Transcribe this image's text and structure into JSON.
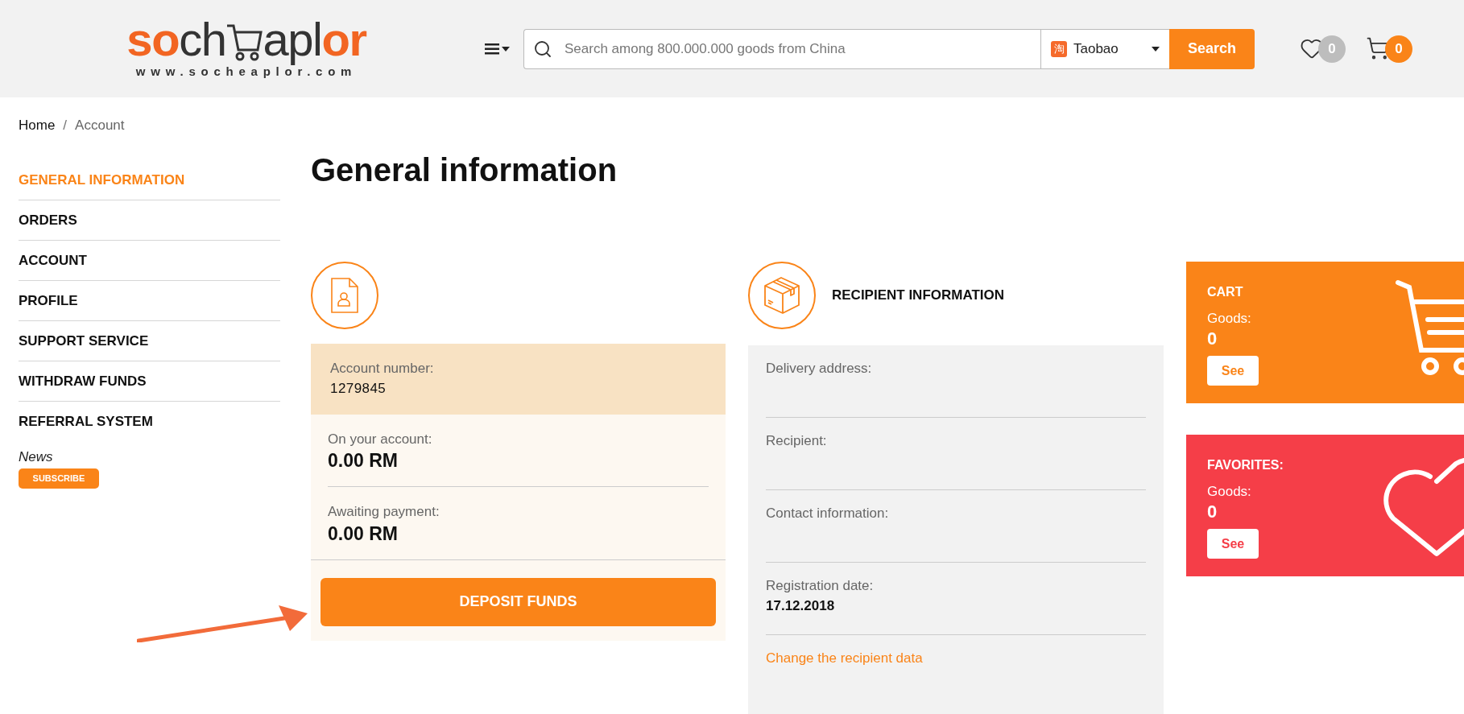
{
  "header": {
    "logo": {
      "parts": [
        {
          "text": "so",
          "color": "#f26522"
        },
        {
          "text": "ch",
          "color": "#333333"
        },
        {
          "text": "apl",
          "color": "#333333"
        },
        {
          "text": "or",
          "color": "#f26522"
        }
      ],
      "tagline": "www.socheaplor.com"
    },
    "search": {
      "placeholder": "Search among 800.000.000 goods from China",
      "source_glyph": "淘",
      "source": "Taobao",
      "button": "Search"
    },
    "favorites_count": "0",
    "cart_count": "0"
  },
  "breadcrumb": {
    "separator": "/",
    "items": [
      {
        "label": "Home",
        "current": false
      },
      {
        "label": "Account",
        "current": true
      }
    ]
  },
  "sidebar": {
    "items": [
      {
        "label": "GENERAL INFORMATION",
        "selected": true
      },
      {
        "label": "ORDERS",
        "selected": false
      },
      {
        "label": "ACCOUNT",
        "selected": false
      },
      {
        "label": "PROFILE",
        "selected": false
      },
      {
        "label": "SUPPORT SERVICE",
        "selected": false
      },
      {
        "label": "WITHDRAW FUNDS",
        "selected": false
      },
      {
        "label": "REFERRAL SYSTEM",
        "selected": false
      }
    ],
    "news": "News",
    "subscribe": "SUBSCRIBE"
  },
  "title": "General information",
  "account_card": {
    "number_label": "Account number:",
    "number": "1279845",
    "balances": [
      {
        "label": "On your account:",
        "value": "0.00 RM"
      },
      {
        "label": "Awaiting payment:",
        "value": "0.00 RM"
      }
    ],
    "deposit_button": "DEPOSIT FUNDS"
  },
  "recipient_card": {
    "title": "RECIPIENT INFORMATION",
    "fields": [
      {
        "label": "Delivery address:"
      },
      {
        "label": "Recipient:"
      },
      {
        "label": "Contact information:"
      },
      {
        "label": "Registration date:",
        "value": "17.12.2018"
      }
    ],
    "change_link": "Change the recipient data"
  },
  "summary_panels": [
    {
      "kind": "cart",
      "title": "CART",
      "goods_label": "Goods:",
      "count": "0",
      "button": "See",
      "color": "#fa8418"
    },
    {
      "kind": "favorites",
      "title": "FAVORITES:",
      "goods_label": "Goods:",
      "count": "0",
      "button": "See",
      "color": "#f53e48"
    }
  ]
}
